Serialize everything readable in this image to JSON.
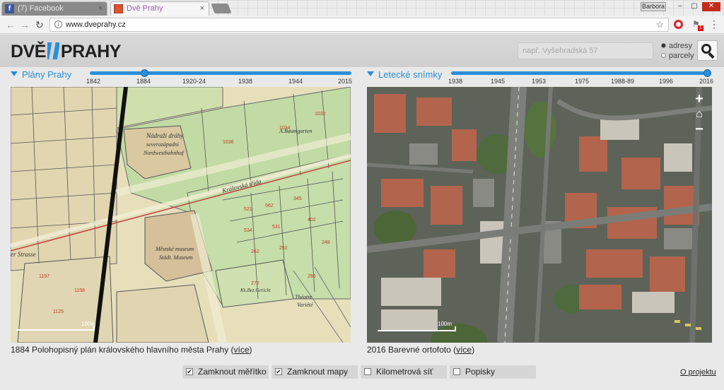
{
  "browser": {
    "tabs": [
      {
        "title": "(7) Facebook",
        "favicon": "f",
        "close": "×"
      },
      {
        "title": "Dvě Prahy",
        "favicon": "",
        "close": "×"
      }
    ],
    "profile": "Barbora",
    "window_controls": {
      "minimize": "–",
      "maximize": "▢",
      "close": "✕"
    },
    "nav": {
      "back": "←",
      "forward": "→",
      "reload": "↻"
    },
    "url": "www.dveprahy.cz",
    "info_icon": "i",
    "bookmark_star": "☆",
    "extension_badge": "1",
    "menu": "⋮"
  },
  "site": {
    "logo_left": "DVĚ",
    "logo_right": "PRAHY",
    "search_placeholder": "např. Vyšehradská 57",
    "search_modes": [
      {
        "label": "adresy",
        "selected": true
      },
      {
        "label": "parcely",
        "selected": false
      }
    ]
  },
  "left_panel": {
    "title": "Plány Prahy",
    "years": [
      "1842",
      "1884",
      "1920-24",
      "1938",
      "1944",
      "2015"
    ],
    "selected_year": "1884",
    "caption": "1884 Polohopisný plán královského hlavního města Prahy (",
    "caption_link": "více",
    "caption_end": ")",
    "scale_label": "100m",
    "map_labels": {
      "station": "Nádraží dráhy\nseverozápadní\nNordwestbahnhof",
      "street": "Královská třída",
      "museum": "Městské museum\nStädt. Museum",
      "theatre": "Théatre\nVariété",
      "baumgarten": "A.Baumgarten",
      "strasse": "er Strasse",
      "burgerschule": "Kk.Bez.Gericht"
    }
  },
  "right_panel": {
    "title": "Letecké snímky",
    "years": [
      "1938",
      "1945",
      "1953",
      "1975",
      "1988-89",
      "1996",
      "2016"
    ],
    "selected_year": "2016",
    "caption": "2016 Barevné ortofoto (",
    "caption_link": "více",
    "caption_end": ")",
    "scale_label": "100m",
    "zoom_in": "+",
    "zoom_out": "−",
    "home": "⌂"
  },
  "options": [
    {
      "label": "Zamknout měřítko",
      "checked": true
    },
    {
      "label": "Zamknout mapy",
      "checked": true
    },
    {
      "label": "Kilometrová síť",
      "checked": false
    },
    {
      "label": "Popisky",
      "checked": false
    }
  ],
  "footer_link": "O projektu",
  "colors": {
    "accent": "#2a8fd6",
    "map_paper": "#e3dcb7",
    "map_green": "#bcd9a0",
    "parcel_red": "#c0392b"
  }
}
